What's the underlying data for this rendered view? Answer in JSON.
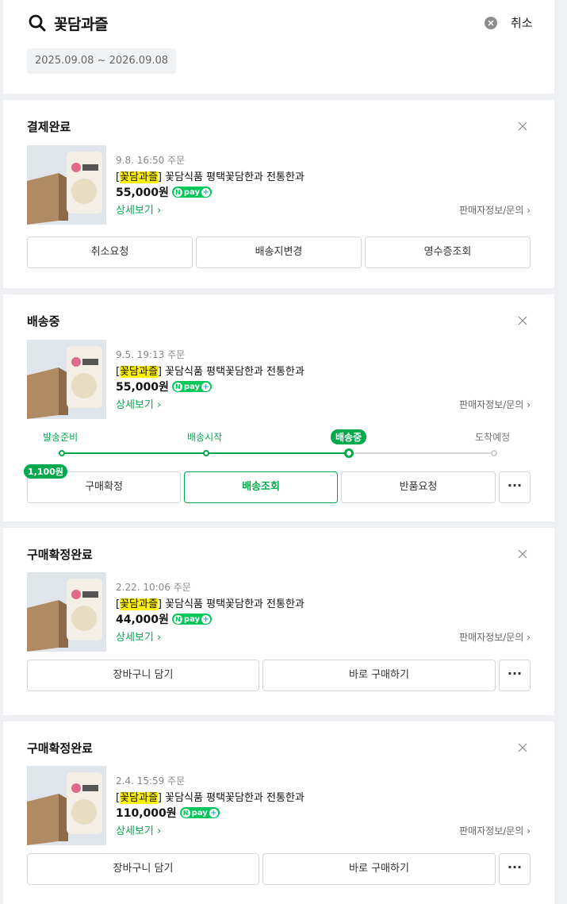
{
  "search": {
    "query": "꽃담과즐",
    "cancel_label": "취소",
    "date_range": "2025.09.08 ~ 2026.09.08"
  },
  "orders": [
    {
      "status": "결제완료",
      "order_time": "9.8. 16:50 주문",
      "brand": "꽃담과즐",
      "product": " 꽃담식품 평택꽃담한과 전통한과",
      "price": "55,000원",
      "detail_label": "상세보기 ›",
      "seller_label": "판매자정보/문의 ›",
      "buttons": [
        "취소요청",
        "배송지변경",
        "영수증조회"
      ]
    },
    {
      "status": "배송중",
      "order_time": "9.5. 19:13 주문",
      "brand": "꽃담과즐",
      "product": " 꽃담식품 평택꽃담한과 전통한과",
      "price": "55,000원",
      "detail_label": "상세보기 ›",
      "seller_label": "판매자정보/문의 ›",
      "progress": {
        "steps": [
          "발송준비",
          "배송시작",
          "배송중",
          "도착예정"
        ],
        "current_step": 2
      },
      "reward_badge": "1,100원",
      "buttons": [
        "구매확정",
        "배송조회",
        "반품요청"
      ],
      "more_label": "···"
    },
    {
      "status": "구매확정완료",
      "order_time": "2.22. 10:06 주문",
      "brand": "꽃담과즐",
      "product": " 꽃담식품 평택꽃담한과 전통한과",
      "price": "44,000원",
      "detail_label": "상세보기 ›",
      "seller_label": "판매자정보/문의 ›",
      "buttons": [
        "장바구니 담기",
        "바로 구매하기"
      ],
      "more_label": "···"
    },
    {
      "status": "구매확정완료",
      "order_time": "2.4. 15:59 주문",
      "brand": "꽃담과즐",
      "product": " 꽃담식품 평택꽃담한과 전통한과",
      "price": "110,000원",
      "detail_label": "상세보기 ›",
      "seller_label": "판매자정보/문의 ›",
      "buttons": [
        "장바구니 담기",
        "바로 구매하기"
      ],
      "more_label": "···"
    }
  ],
  "npay": {
    "n": "N",
    "text": "pay",
    "plus": "+"
  },
  "colors": {
    "accent": "#03a94d",
    "highlight": "#fff200",
    "npay_blue": "#19b4e6"
  }
}
